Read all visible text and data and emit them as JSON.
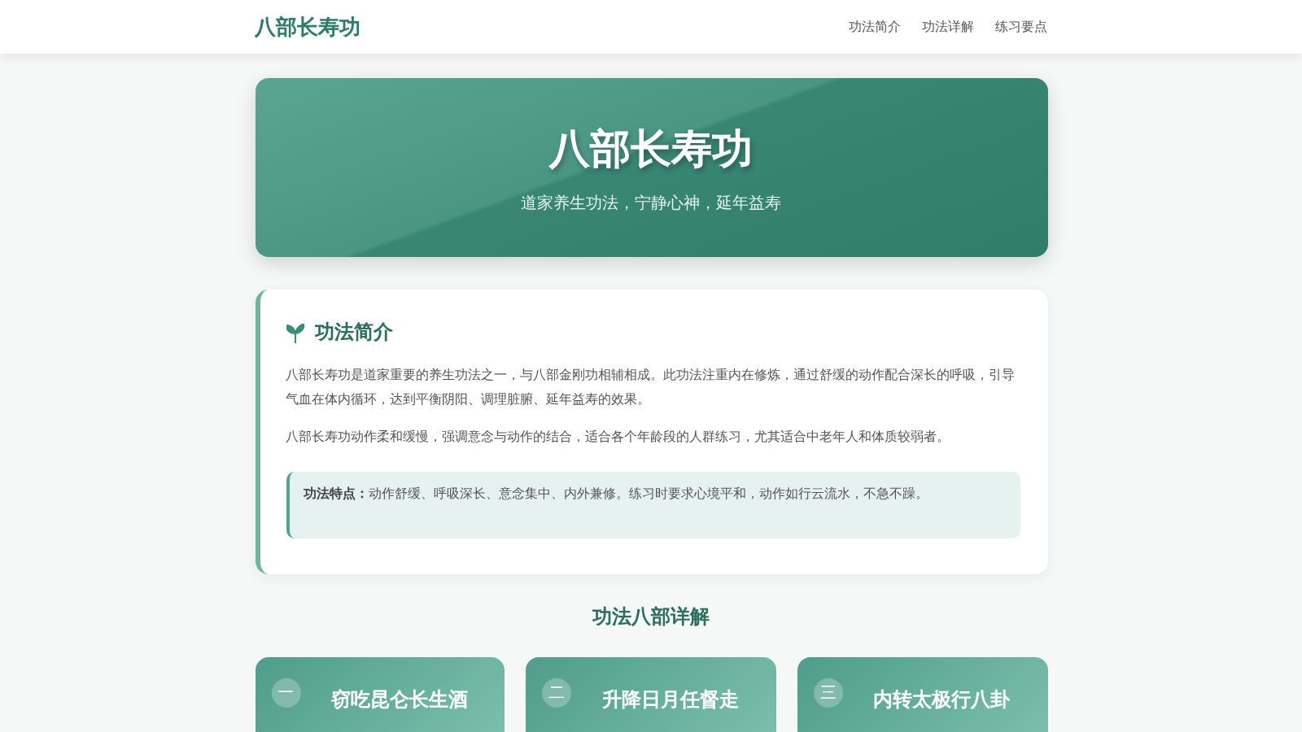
{
  "nav": {
    "brand": "八部长寿功",
    "links": [
      "功法简介",
      "功法详解",
      "练习要点"
    ]
  },
  "hero": {
    "title": "八部长寿功",
    "subtitle": "道家养生功法，宁静心神，延年益寿"
  },
  "intro": {
    "heading": "功法简介",
    "paragraphs": [
      "八部长寿功是道家重要的养生功法之一，与八部金刚功相辅相成。此功法注重内在修炼，通过舒缓的动作配合深长的呼吸，引导气血在体内循环，达到平衡阴阳、调理脏腑、延年益寿的效果。",
      "八部长寿功动作柔和缓慢，强调意念与动作的结合，适合各个年龄段的人群练习，尤其适合中老年人和体质较弱者。"
    ],
    "note": "**功法特点：**动作舒缓、呼吸深长、意念集中、内外兼修。练习时要求心境平和，动作如行云流水，不急不躁。"
  },
  "details": {
    "heading": "功法八部详解",
    "moves": [
      {
        "number": "一",
        "name": "窃吃昆仑长生酒"
      },
      {
        "number": "二",
        "name": "升降日月任督走"
      },
      {
        "number": "三",
        "name": "内转太极行八卦"
      }
    ]
  }
}
